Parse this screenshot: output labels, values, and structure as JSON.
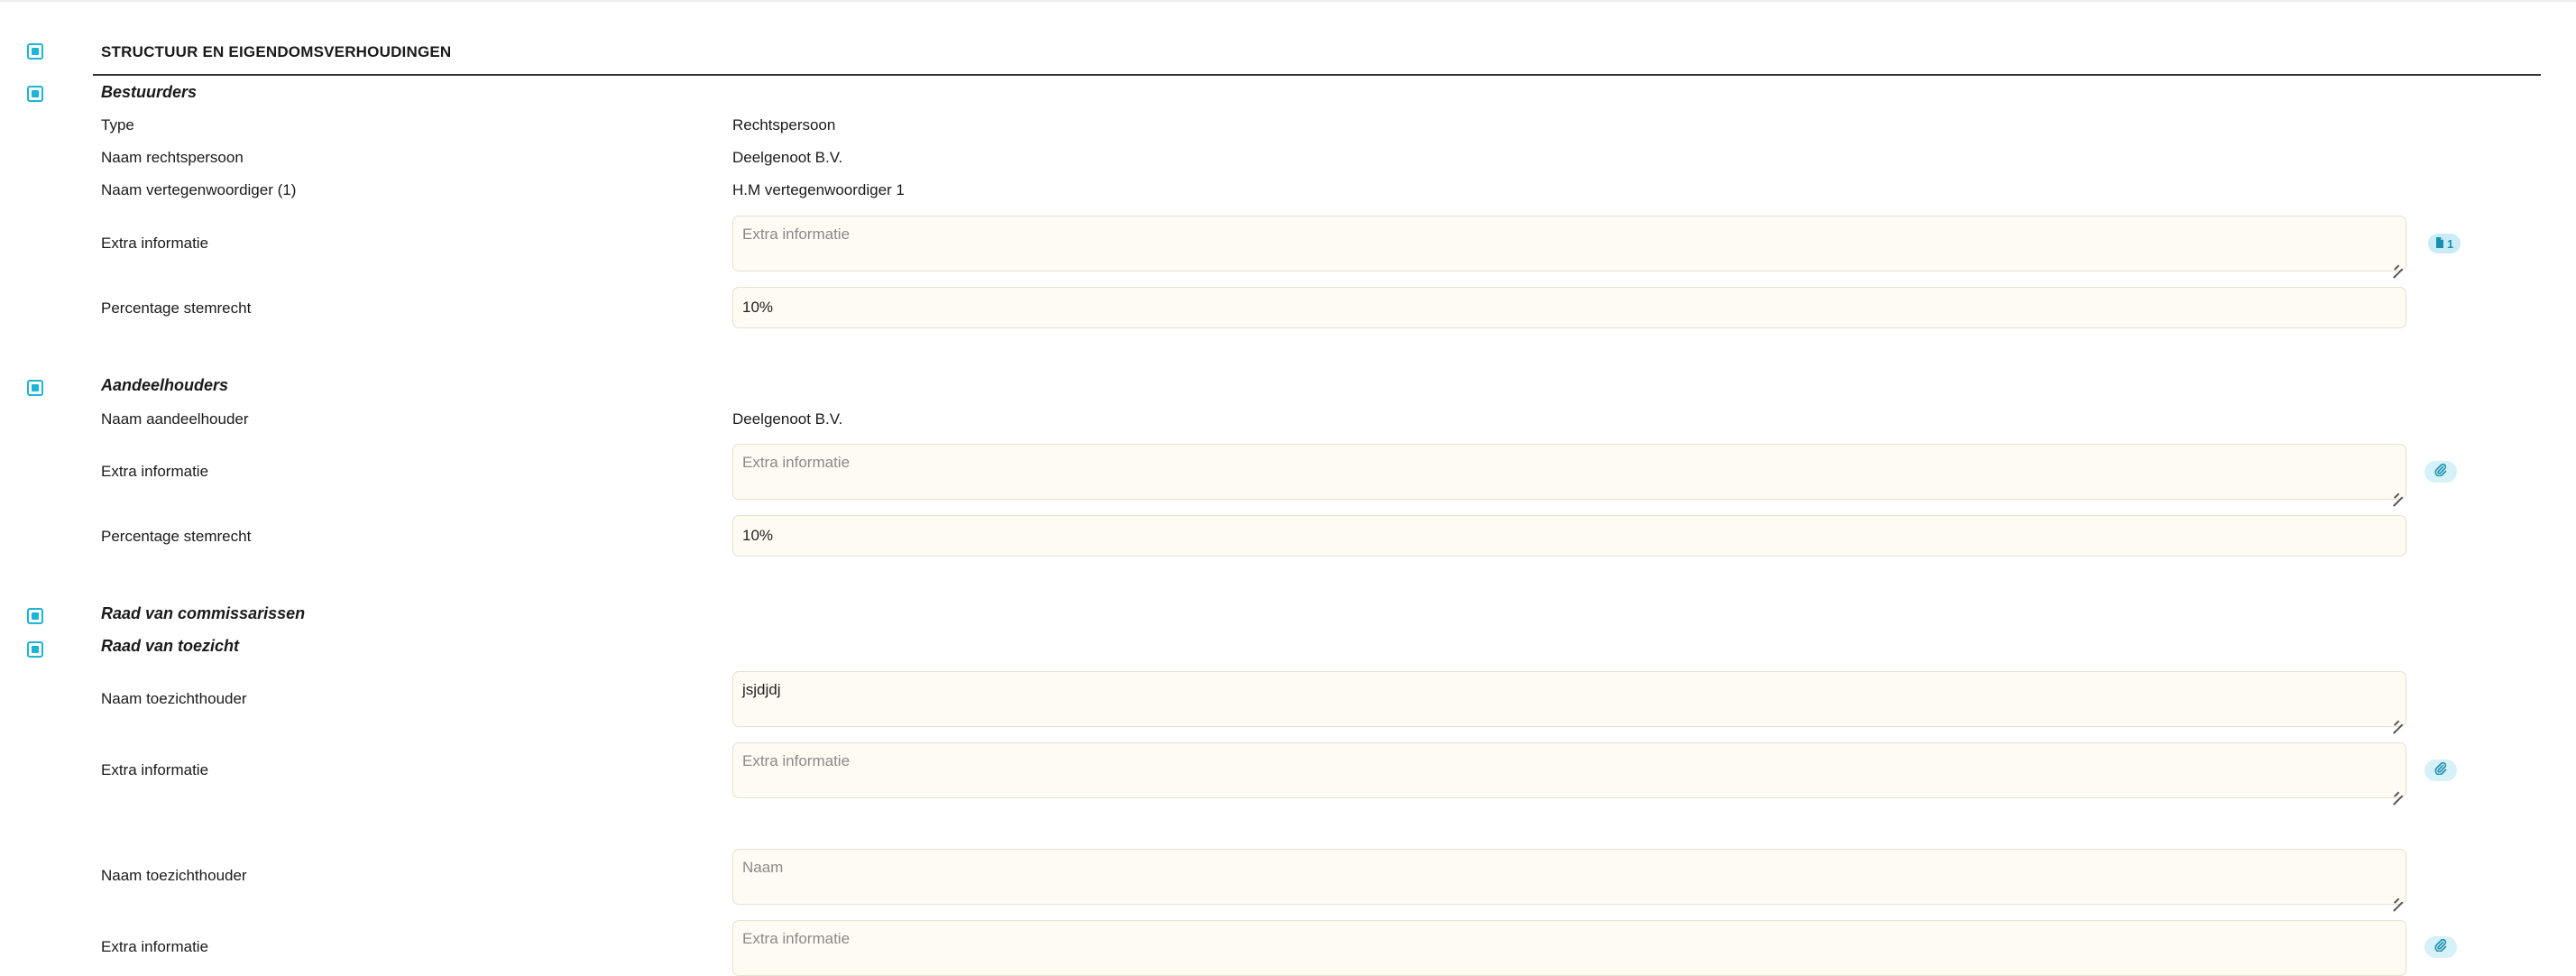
{
  "section": {
    "title": "STRUCTUUR EN EIGENDOMSVERHOUDINGEN"
  },
  "bestuurders": {
    "title": "Bestuurders",
    "type_label": "Type",
    "type_value": "Rechtspersoon",
    "naam_label": "Naam rechtspersoon",
    "naam_value": "Deelgenoot B.V.",
    "vertegenwoordiger_label": "Naam vertegenwoordiger (1)",
    "vertegenwoordiger_value": "H.M vertegenwoordiger 1",
    "extra_label": "Extra informatie",
    "extra_placeholder": "Extra informatie",
    "extra_value": "",
    "attachment_count": "1",
    "stemrecht_label": "Percentage stemrecht",
    "stemrecht_value": "10%"
  },
  "aandeelhouders": {
    "title": "Aandeelhouders",
    "naam_label": "Naam aandeelhouder",
    "naam_value": "Deelgenoot B.V.",
    "extra_label": "Extra informatie",
    "extra_placeholder": "Extra informatie",
    "extra_value": "",
    "stemrecht_label": "Percentage stemrecht",
    "stemrecht_value": "10%"
  },
  "commissarissen": {
    "title": "Raad van commissarissen"
  },
  "toezicht": {
    "title": "Raad van toezicht",
    "items": [
      {
        "naam_label": "Naam toezichthouder",
        "naam_value": "jsjdjdj",
        "naam_placeholder": "Naam",
        "extra_label": "Extra informatie",
        "extra_placeholder": "Extra informatie",
        "extra_value": ""
      },
      {
        "naam_label": "Naam toezichthouder",
        "naam_value": "",
        "naam_placeholder": "Naam",
        "extra_label": "Extra informatie",
        "extra_placeholder": "Extra informatie",
        "extra_value": ""
      }
    ]
  },
  "colors": {
    "accent": "#1cb5d6",
    "field_bg": "#fefbf3",
    "badge_bg": "#d7f1f8"
  },
  "icons": {
    "attachment": "paperclip-icon",
    "document": "document-icon",
    "checkbox": "checkbox-icon"
  }
}
